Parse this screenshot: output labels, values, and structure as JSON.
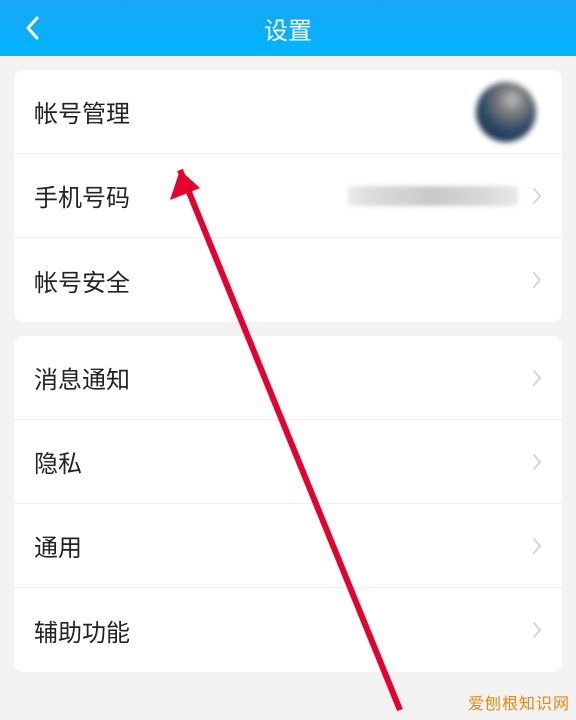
{
  "header": {
    "title": "设置"
  },
  "groups": [
    {
      "rows": [
        {
          "label": "帐号管理",
          "showAvatar": true,
          "showChevron": false
        },
        {
          "label": "手机号码",
          "showBlurValue": true,
          "showChevron": true
        },
        {
          "label": "帐号安全",
          "showChevron": true
        }
      ]
    },
    {
      "rows": [
        {
          "label": "消息通知",
          "showChevron": true
        },
        {
          "label": "隐私",
          "showChevron": true
        },
        {
          "label": "通用",
          "showChevron": true
        },
        {
          "label": "辅助功能",
          "showChevron": true
        }
      ]
    }
  ],
  "watermark": "爱刨根知识网",
  "annotation": {
    "arrowColor": "#e6002d"
  }
}
